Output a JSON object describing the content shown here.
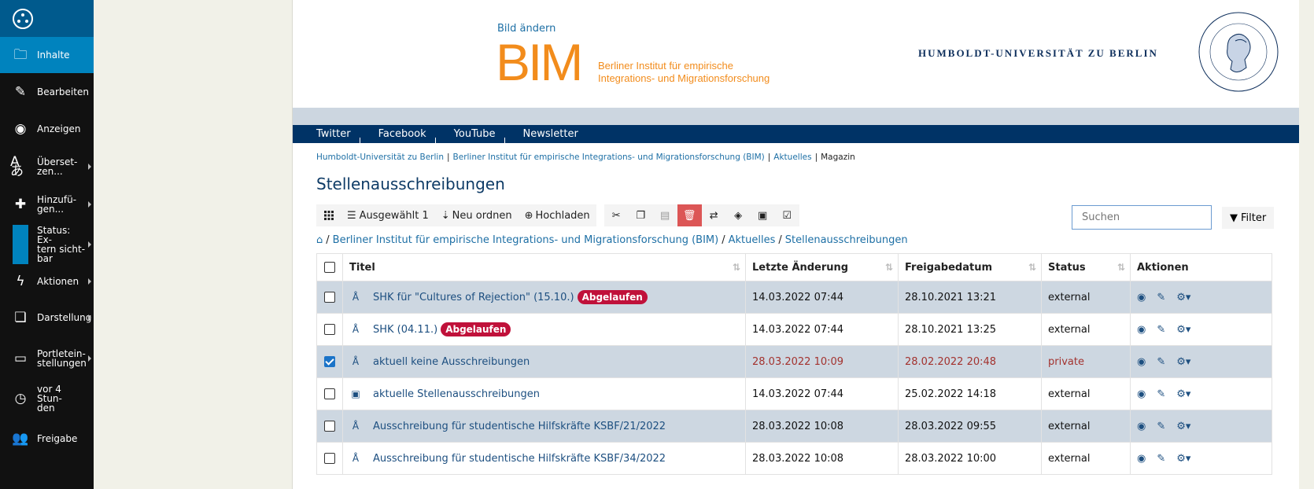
{
  "sidebar": {
    "items": [
      {
        "label": "Inhalte",
        "icon": "folder-icon",
        "active": true
      },
      {
        "label": "Bearbeiten",
        "icon": "pencil-icon"
      },
      {
        "label": "Anzeigen",
        "icon": "eye-icon"
      },
      {
        "label": "Überset-\nzen...",
        "icon": "translate-icon",
        "arrow": true
      },
      {
        "label": "Hinzufü-\ngen...",
        "icon": "plus-icon",
        "arrow": true
      },
      {
        "label": "Status: Ex-\ntern sicht-\nbar",
        "icon": "status-icon",
        "arrow": true
      },
      {
        "label": "Aktionen",
        "icon": "lightning-icon",
        "arrow": true
      },
      {
        "label": "Darstellung",
        "icon": "display-icon",
        "arrow": true
      },
      {
        "label": "Portletein-\nstellungen",
        "icon": "portlet-icon",
        "arrow": true
      },
      {
        "label": "vor 4 Stun-\nden",
        "icon": "clock-icon"
      },
      {
        "label": "Freigabe",
        "icon": "users-icon"
      }
    ]
  },
  "header": {
    "bild_aendern": "Bild ändern",
    "bim_logo": "BIM",
    "bim_sub_1": "Berliner Institut für empirische",
    "bim_sub_2": "Integrations- und Migrationsforschung",
    "hu_name": "HUMBOLDT-UNIVERSITÄT ZU BERLIN"
  },
  "social": [
    "Twitter",
    "Facebook",
    "YouTube",
    "Newsletter"
  ],
  "breadcrumb_top": {
    "items": [
      "Humboldt-Universität zu Berlin",
      "Berliner Institut für empirische Integrations- und Migrationsforschung (BIM)",
      "Aktuelles"
    ],
    "current": "Magazin"
  },
  "page_title": "Stellenausschreibungen",
  "toolbar": {
    "selected": "Ausgewählt 1",
    "reorder": "Neu ordnen",
    "upload": "Hochladen",
    "search_placeholder": "Suchen",
    "filter": "Filter"
  },
  "breadcrumb_content": [
    "Berliner Institut für empirische Integrations- und Migrationsforschung (BIM)",
    "Aktuelles",
    "Stellenausschreibungen"
  ],
  "table": {
    "headers": [
      "Titel",
      "Letzte Änderung",
      "Freigabedatum",
      "Status",
      "Aktionen"
    ],
    "rows": [
      {
        "title": "SHK für \"Cultures of Rejection\" (15.10.)",
        "badge": "Abgelaufen",
        "modified": "14.03.2022 07:44",
        "published": "28.10.2021 13:21",
        "status": "external",
        "checked": false,
        "icon": "news-icon"
      },
      {
        "title": "SHK (04.11.)",
        "badge": "Abgelaufen",
        "modified": "14.03.2022 07:44",
        "published": "28.10.2021 13:25",
        "status": "external",
        "checked": false,
        "icon": "news-icon"
      },
      {
        "title": "aktuell keine Ausschreibungen",
        "badge": "",
        "modified": "28.03.2022 10:09",
        "published": "28.02.2022 20:48",
        "status": "private",
        "checked": true,
        "icon": "news-icon"
      },
      {
        "title": "aktuelle Stellenausschreibungen",
        "badge": "",
        "modified": "14.03.2022 07:44",
        "published": "25.02.2022 14:18",
        "status": "external",
        "checked": false,
        "icon": "collection-icon"
      },
      {
        "title": "Ausschreibung für studentische Hilfskräfte KSBF/21/2022",
        "badge": "",
        "modified": "28.03.2022 10:08",
        "published": "28.03.2022 09:55",
        "status": "external",
        "checked": false,
        "icon": "news-icon"
      },
      {
        "title": "Ausschreibung für studentische Hilfskräfte KSBF/34/2022",
        "badge": "",
        "modified": "28.03.2022 10:08",
        "published": "28.03.2022 10:00",
        "status": "external",
        "checked": false,
        "icon": "news-icon"
      }
    ]
  }
}
